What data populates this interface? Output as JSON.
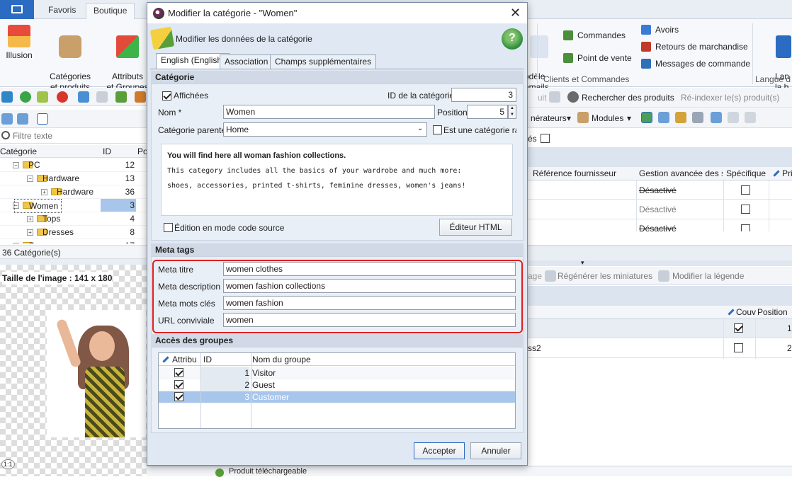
{
  "ribbon": {
    "tabs": [
      "Favoris",
      "Boutique"
    ],
    "big_buttons": [
      {
        "label": "Illusion"
      },
      {
        "label": "Catégories\net produits"
      },
      {
        "label": "Attributs\net Groupes"
      }
    ],
    "modele": "odèle\nemails",
    "small": {
      "commandes": "Commandes",
      "point_vente": "Point de vente",
      "avoirs": "Avoirs",
      "retours": "Retours de marchandise",
      "messages": "Messages de commande"
    },
    "group_clients": "Clients et Commandes",
    "lang_btn": "Lan\nla b",
    "group_langue": "Langue d"
  },
  "left": {
    "filter_placeholder": "Filtre texte",
    "tree_headers": {
      "cat": "Catégorie",
      "id": "ID",
      "pos": "Po"
    },
    "tree": [
      {
        "name": "PC",
        "id": "12",
        "indent": 1
      },
      {
        "name": "Hardware",
        "id": "13",
        "indent": 2
      },
      {
        "name": "Hardware",
        "id": "36",
        "indent": 3
      },
      {
        "name": "Women",
        "id": "3",
        "indent": 1
      },
      {
        "name": "Tops",
        "id": "4",
        "indent": 2
      },
      {
        "name": "Dresses",
        "id": "8",
        "indent": 2
      },
      {
        "name": "C",
        "id": "17",
        "indent": 1
      }
    ],
    "count": "36 Catégorie(s)",
    "image_size": "Taille de l'image : 141 x 180",
    "zoom": "1:1"
  },
  "right": {
    "toolbar1": {
      "uit": "uit",
      "search": "Rechercher des produits",
      "reindex": "Ré-indexer le(s) produit(s)"
    },
    "toolbar2": {
      "generators": "nérateurs",
      "modules": "Modules"
    },
    "res": "és",
    "grid_headers": {
      "ref": "Référence fournisseur",
      "gestion": "Gestion avancée des sto",
      "spec": "Spécifique",
      "pri": "Pri"
    },
    "rows": [
      "Désactivé",
      "Désactivé",
      "Désactivé"
    ],
    "img_toolbar": {
      "age": "age",
      "regen": "Régénérer les miniatures",
      "legend": "Modifier la légende"
    },
    "img_headers": {
      "couv": "Couv",
      "pos": "Position"
    },
    "img_rows": [
      {
        "name": "",
        "pos": "1"
      },
      {
        "name": "ss2",
        "pos": "2"
      }
    ],
    "bottom": "Produit téléchargeable"
  },
  "dialog": {
    "title": "Modifier la catégorie - \"Women\"",
    "subtitle": "Modifier les données de la catégorie",
    "tabs": [
      "English (English)",
      "Association",
      "Champs supplémentaires"
    ],
    "section_categorie": "Catégorie",
    "affichees": "Affichées",
    "id_label": "ID de la catégorie",
    "id_value": "3",
    "nom_label": "Nom *",
    "nom_value": "Women",
    "position_label": "Position",
    "position_value": "5",
    "parent_label": "Catégorie parente",
    "parent_value": "Home",
    "root_label": "Est une catégorie ra",
    "desc_title": "You will find here all woman fashion collections.",
    "desc_line1": "This category includes all the basics of your wardrobe and much more:",
    "desc_line2": "shoes, accessories, printed t-shirts, feminine dresses, women's jeans!",
    "source_mode": "Édition en mode code source",
    "html_editor": "Éditeur HTML",
    "section_meta": "Meta tags",
    "meta": [
      {
        "label": "Meta titre",
        "value": "women clothes"
      },
      {
        "label": "Meta description",
        "value": "women fashion collections"
      },
      {
        "label": "Meta mots clés",
        "value": "women fashion"
      },
      {
        "label": "URL conviviale",
        "value": "women"
      }
    ],
    "section_groups": "Accès des groupes",
    "group_headers": {
      "attr": "Attribu",
      "id": "ID",
      "name": "Nom du groupe"
    },
    "groups": [
      {
        "id": "1",
        "name": "Visitor"
      },
      {
        "id": "2",
        "name": "Guest"
      },
      {
        "id": "3",
        "name": "Customer"
      }
    ],
    "ok": "Accepter",
    "cancel": "Annuler"
  },
  "colors": {
    "highlight": "#e02020",
    "selection": "#a8c6ec",
    "accent": "#2b6bc1"
  }
}
